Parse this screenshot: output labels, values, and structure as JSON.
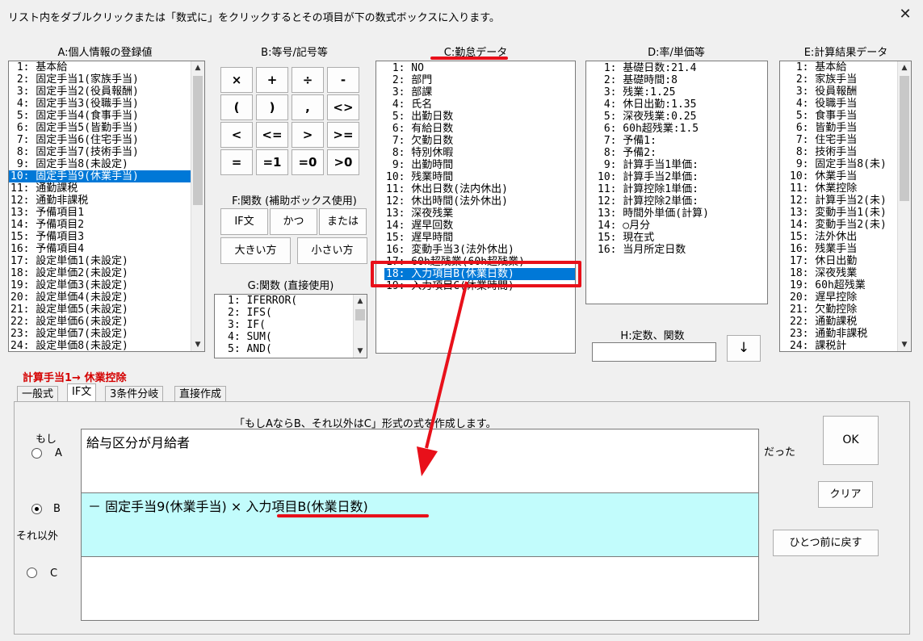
{
  "window": {
    "title": "リスト内をダブルクリックまたは「数式に」をクリックするとその項目が下の数式ボックスに入ります。",
    "close_glyph": "✕"
  },
  "sectionA": {
    "label": "A:個人情報の登録値",
    "items": [
      " 1: 基本給",
      " 2: 固定手当1(家族手当)",
      " 3: 固定手当2(役員報酬)",
      " 4: 固定手当3(役職手当)",
      " 5: 固定手当4(食事手当)",
      " 6: 固定手当5(皆勤手当)",
      " 7: 固定手当6(住宅手当)",
      " 8: 固定手当7(技術手当)",
      " 9: 固定手当8(未設定)",
      "10: 固定手当9(休業手当)",
      "11: 通勤課税",
      "12: 通勤非課税",
      "13: 予備項目1",
      "14: 予備項目2",
      "15: 予備項目3",
      "16: 予備項目4",
      "17: 設定単価1(未設定)",
      "18: 設定単価2(未設定)",
      "19: 設定単価3(未設定)",
      "20: 設定単価4(未設定)",
      "21: 設定単価5(未設定)",
      "22: 設定単価6(未設定)",
      "23: 設定単価7(未設定)",
      "24: 設定単価8(未設定)"
    ],
    "selected_index": 9
  },
  "sectionB": {
    "label": "B:等号/記号等",
    "buttons": [
      "×",
      "+",
      "÷",
      "-",
      "(",
      ")",
      ",",
      "<>",
      "<",
      "<=",
      ">",
      ">=",
      "=",
      "=1",
      "=0",
      ">0"
    ]
  },
  "sectionF": {
    "label": "F:関数 (補助ボックス使用)",
    "buttons": [
      "IF文",
      "かつ",
      "または",
      "大きい方",
      "小さい方"
    ]
  },
  "sectionG": {
    "label": "G:関数 (直接使用)",
    "items": [
      "1: IFERROR(",
      "2: IFS(",
      "3: IF(",
      "4: SUM(",
      "5: AND("
    ]
  },
  "sectionC": {
    "label": "C:勤怠データ",
    "items": [
      " 1: NO",
      " 2: 部門",
      " 3: 部課",
      " 4: 氏名",
      " 5: 出勤日数",
      " 6: 有給日数",
      " 7: 欠勤日数",
      " 8: 特別休暇",
      " 9: 出勤時間",
      "10: 残業時間",
      "11: 休出日数(法内休出)",
      "12: 休出時間(法外休出)",
      "13: 深夜残業",
      "14: 遅早回数",
      "15: 遅早時間",
      "16: 変動手当3(法外休出)",
      "17: 60h超残業(60h超残業)",
      "18: 入力項目B(休業日数)",
      "19: 入力項目C(休業時間)"
    ],
    "selected_index": 17
  },
  "sectionD": {
    "label": "D:率/単価等",
    "items": [
      " 1: 基礎日数:21.4",
      " 2: 基礎時間:8",
      " 3: 残業:1.25",
      " 4: 休日出勤:1.35",
      " 5: 深夜残業:0.25",
      " 6: 60h超残業:1.5",
      " 7: 予備1:",
      " 8: 予備2:",
      " 9: 計算手当1単価:",
      "10: 計算手当2単価:",
      "11: 計算控除1単価:",
      "12: 計算控除2単価:",
      "13: 時間外単価(計算)",
      "14: ○月分",
      "15: 現在式",
      "16: 当月所定日数"
    ]
  },
  "sectionE": {
    "label": "E:計算結果データ",
    "items": [
      " 1: 基本給",
      " 2: 家族手当",
      " 3: 役員報酬",
      " 4: 役職手当",
      " 5: 食事手当",
      " 6: 皆勤手当",
      " 7: 住宅手当",
      " 8: 技術手当",
      " 9: 固定手当8(未)",
      "10: 休業手当",
      "11: 休業控除",
      "12: 計算手当2(未)",
      "13: 変動手当1(未)",
      "14: 変動手当2(未)",
      "15: 法外休出",
      "16: 残業手当",
      "17: 休日出勤",
      "18: 深夜残業",
      "19: 60h超残業",
      "20: 遅早控除",
      "21: 欠勤控除",
      "22: 通勤課税",
      "23: 通勤非課税",
      "24: 課税計"
    ]
  },
  "sectionH": {
    "label": "H:定数、関数",
    "input_value": "",
    "arrow_button": "↓"
  },
  "formula_target": "計算手当1→ 休業控除",
  "tabs": [
    "一般式",
    "IF文",
    "3条件分岐",
    "直接作成"
  ],
  "active_tab": 1,
  "if_panel": {
    "description": "「もしAならB、それ以外はC」形式の式を作成します。",
    "moshi_label": "もし",
    "dattara_label": "だった",
    "soreigai_label": "それ以外",
    "radio_a": "A",
    "radio_b": "B",
    "radio_c": "C",
    "selected_radio": "B",
    "box_a_text": "給与区分が月給者",
    "box_b_text": "－ 固定手当9(休業手当) × 入力項目B(休業日数)",
    "box_c_text": ""
  },
  "buttons": {
    "ok": "OK",
    "clear": "クリア",
    "undo": "ひとつ前に戻す"
  },
  "colors": {
    "selection": "#0078d7",
    "annotation_red": "#e8101a",
    "box_b_bg": "#c2fcfc",
    "title_red": "#d40000"
  }
}
